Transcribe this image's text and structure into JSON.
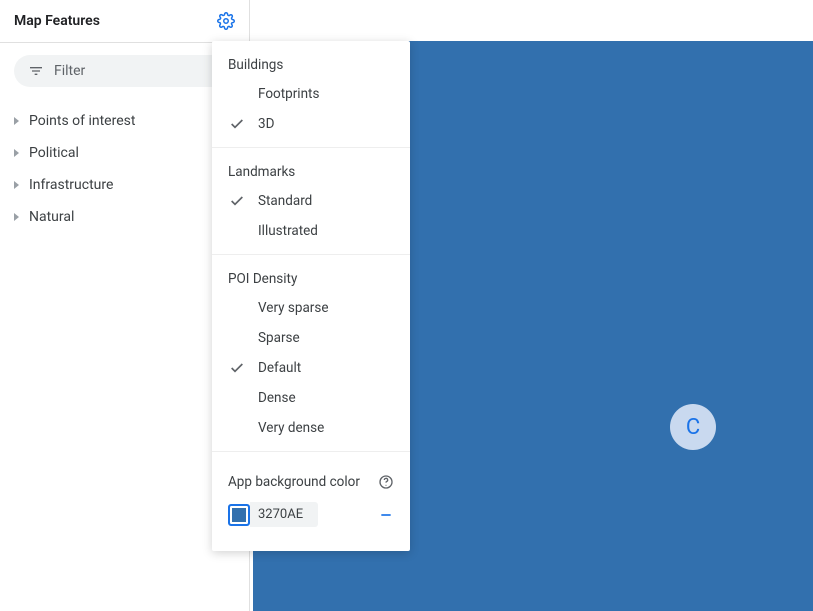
{
  "sidebar": {
    "title": "Map Features",
    "filter_placeholder": "Filter",
    "items": [
      "Points of interest",
      "Political",
      "Infrastructure",
      "Natural"
    ]
  },
  "popover": {
    "sections": [
      {
        "heading": "Buildings",
        "items": [
          {
            "label": "Footprints",
            "checked": false
          },
          {
            "label": "3D",
            "checked": true
          }
        ]
      },
      {
        "heading": "Landmarks",
        "items": [
          {
            "label": "Standard",
            "checked": true
          },
          {
            "label": "Illustrated",
            "checked": false
          }
        ]
      },
      {
        "heading": "POI Density",
        "items": [
          {
            "label": "Very sparse",
            "checked": false
          },
          {
            "label": "Sparse",
            "checked": false
          },
          {
            "label": "Default",
            "checked": true
          },
          {
            "label": "Dense",
            "checked": false
          },
          {
            "label": "Very dense",
            "checked": false
          }
        ]
      }
    ],
    "bgcolor_label": "App background color",
    "bgcolor_hex": "3270AE"
  },
  "canvas": {
    "badge_letter": "C",
    "background_color": "#3270AE"
  }
}
